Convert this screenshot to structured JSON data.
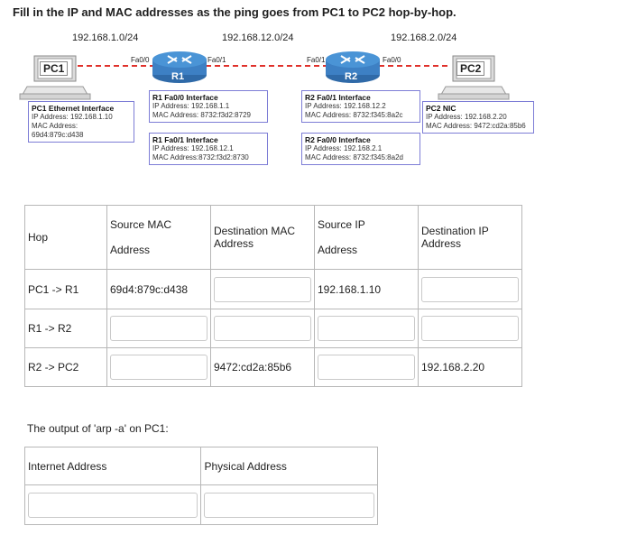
{
  "question": "Fill in the IP and MAC addresses as the ping goes from PC1 to PC2 hop-by-hop.",
  "topology": {
    "networks": [
      "192.168.1.0/24",
      "192.168.12.0/24",
      "192.168.2.0/24"
    ],
    "pc1": {
      "label": "PC1",
      "info_title": "PC1 Ethernet Interface",
      "ip": "IP Address: 192.168.1.10",
      "mac": "MAC Address: 69d4:879c:d438"
    },
    "pc2": {
      "label": "PC2",
      "info_title": "PC2 NIC",
      "ip": "IP Address: 192.168.2.20",
      "mac": "MAC Address: 9472:cd2a:85b6"
    },
    "r1": {
      "label": "R1",
      "port_left": "Fa0/0",
      "port_right": "Fa0/1",
      "fa00_title": "R1 Fa0/0 Interface",
      "fa00_ip": "IP Address: 192.168.1.1",
      "fa00_mac": "MAC Address: 8732:f3d2:8729",
      "fa01_title": "R1 Fa0/1 Interface",
      "fa01_ip": "IP Address: 192.168.12.1",
      "fa01_mac": "MAC Address:8732:f3d2:8730"
    },
    "r2": {
      "label": "R2",
      "port_left": "Fa0/1",
      "port_right": "Fa0/0",
      "fa01_title": "R2 Fa0/1 Interface",
      "fa01_ip": "IP Address: 192.168.12.2",
      "fa01_mac": "MAC Address: 8732:f345:8a2c",
      "fa00_title": "R2 Fa0/0 Interface",
      "fa00_ip": "IP Address: 192.168.2.1",
      "fa00_mac": "MAC Address: 8732:f345:8a2d"
    }
  },
  "hop_table": {
    "headers": [
      "Hop",
      "Source MAC",
      "Address",
      "Destination MAC",
      "Address",
      "Source IP",
      "Address",
      "Destination IP",
      "Address"
    ],
    "rows": [
      {
        "hop": "PC1 -> R1",
        "src_mac": "69d4:879c:d438",
        "dst_mac": "",
        "src_ip": "192.168.1.10",
        "dst_ip": ""
      },
      {
        "hop": "R1 -> R2",
        "src_mac": "",
        "dst_mac": "",
        "src_ip": "",
        "dst_ip": ""
      },
      {
        "hop": "R2 -> PC2",
        "src_mac": "",
        "dst_mac": "9472:cd2a:85b6",
        "src_ip": "",
        "dst_ip": "192.168.2.20"
      }
    ]
  },
  "arp": {
    "caption": "The output of 'arp -a' on PC1:",
    "headers": [
      "Internet Address",
      "Physical Address"
    ]
  }
}
